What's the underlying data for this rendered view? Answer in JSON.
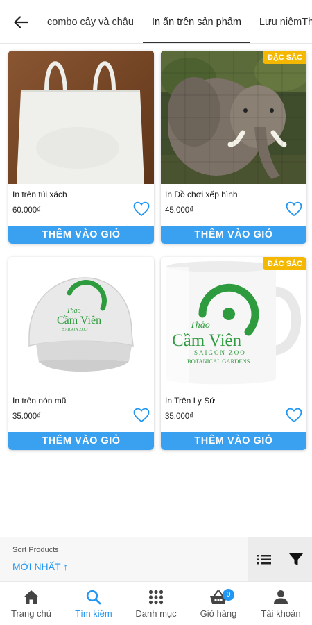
{
  "header": {
    "tabs": [
      {
        "label": "combo cây và chậu",
        "active": false
      },
      {
        "label": "In ấn trên sản phẩm",
        "active": true
      },
      {
        "label": "Lưu niệmTh",
        "active": false
      }
    ]
  },
  "products": [
    {
      "name": "In trên túi xách",
      "price": "60.000₫",
      "badge": "",
      "button": "THÊM VÀO GIỎ",
      "image": "tote-bag"
    },
    {
      "name": "In Đồ chơi xếp hình",
      "price": "45.000₫",
      "badge": "ĐẶC SẮC",
      "button": "THÊM VÀO GIỎ",
      "image": "elephant-puzzle"
    },
    {
      "name": "In trên nón mũ",
      "price": "35.000₫",
      "badge": "",
      "button": "THÊM VÀO GIỎ",
      "image": "cap"
    },
    {
      "name": "In Trên Ly Sứ",
      "price": "35.000₫",
      "badge": "ĐẶC SẮC",
      "button": "THÊM VÀO GIỎ",
      "image": "mug"
    }
  ],
  "logo": {
    "line1": "Thảo",
    "line2": "Cầm Viên",
    "line3": "SAIGON ZOO",
    "line4": "BOTANICAL GARDENS"
  },
  "sort": {
    "label": "Sort Products",
    "value": "MỚI NHẤT ↑"
  },
  "bottom_nav": {
    "items": [
      {
        "label": "Trang chủ",
        "icon": "home-icon",
        "active": false
      },
      {
        "label": "Tìm kiếm",
        "icon": "search-icon",
        "active": true
      },
      {
        "label": "Danh mục",
        "icon": "grid-icon",
        "active": false
      },
      {
        "label": "Giỏ hàng",
        "icon": "cart-icon",
        "active": false
      },
      {
        "label": "Tài khoản",
        "icon": "account-icon",
        "active": false
      }
    ],
    "cart_count": "0"
  },
  "colors": {
    "accent": "#2196f3",
    "button": "#3aa0f0",
    "badge": "#f5b800",
    "logo_green": "#2e9b3e"
  }
}
